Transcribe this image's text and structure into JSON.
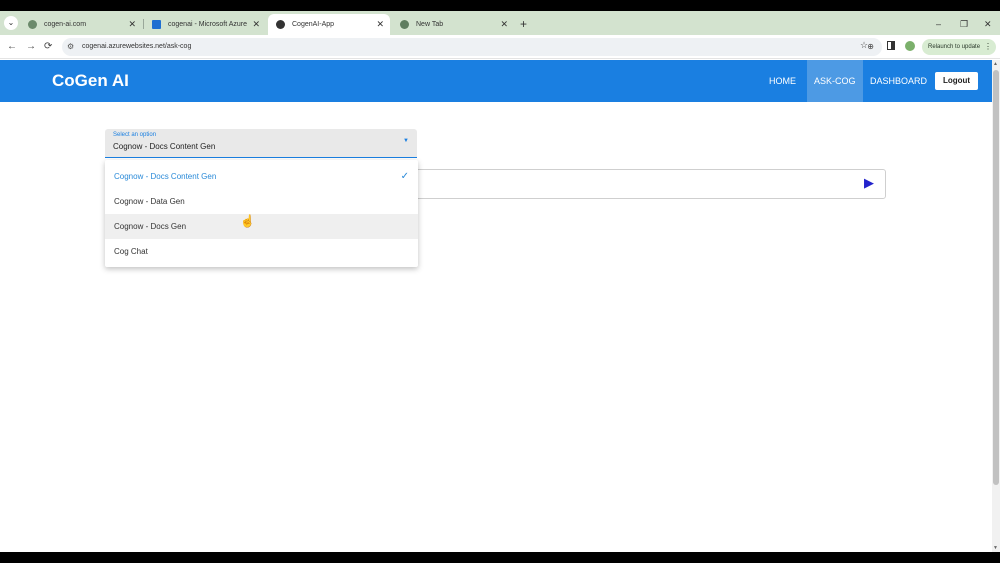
{
  "browser": {
    "tabs": [
      {
        "title": "cogen-ai.com",
        "favicon_color": "#6b8a6b"
      },
      {
        "title": "cogenai - Microsoft Azure",
        "favicon_color": "#1f6fd1"
      },
      {
        "title": "CogenAI-App",
        "favicon_color": "#333333"
      },
      {
        "title": "New Tab",
        "favicon_color": "#5f7d5f"
      }
    ],
    "new_tab_glyph": "+",
    "close_glyph": "✕",
    "window_controls": [
      "–",
      "❐",
      "✕"
    ],
    "nav": {
      "back": "←",
      "forward": "→",
      "reload": "⟳"
    },
    "url": "cogenai.azurewebsites.net/ask-cog",
    "relaunch_label": "Relaunch to update",
    "icons": [
      "search-tabs-icon",
      "translate-icon",
      "star-icon",
      "side-panel-icon",
      "profile-icon",
      "kebab-menu-icon"
    ]
  },
  "app": {
    "brand": "CoGen AI",
    "nav": [
      {
        "label": "HOME",
        "active": false
      },
      {
        "label": "ASK-COG",
        "active": true
      },
      {
        "label": "DASHBOARD",
        "active": false
      }
    ],
    "logout_label": "Logout",
    "accent_color": "#1a7fe1"
  },
  "select": {
    "label": "Select an option",
    "value": "Cognow - Docs Content Gen",
    "options": [
      {
        "label": "Cognow - Docs Content Gen",
        "selected": true
      },
      {
        "label": "Cognow - Data Gen",
        "selected": false
      },
      {
        "label": "Cognow - Docs Gen",
        "selected": false,
        "hover": true
      },
      {
        "label": "Cog Chat",
        "selected": false
      }
    ]
  },
  "prompt": {
    "placeholder": "",
    "value": ""
  },
  "send_glyph": "▶"
}
